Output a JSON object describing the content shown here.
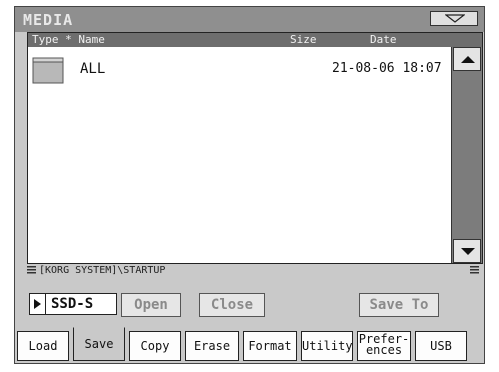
{
  "window": {
    "title": "MEDIA"
  },
  "list": {
    "headers": {
      "type_name": "Type * Name",
      "size": "Size",
      "date": "Date"
    },
    "rows": [
      {
        "name": "ALL",
        "size": "",
        "date": "21-08-06 18:07",
        "icon": "folder-icon"
      }
    ]
  },
  "path": {
    "text": "[KORG SYSTEM]\\STARTUP"
  },
  "device": {
    "label": "SSD-S"
  },
  "buttons": {
    "open": "Open",
    "close": "Close",
    "save_to": "Save To"
  },
  "tabs": {
    "load": "Load",
    "save": "Save",
    "copy": "Copy",
    "erase": "Erase",
    "format": "Format",
    "utility": "Utility",
    "prefs_line1": "Prefer-",
    "prefs_line2": "ences",
    "usb": "USB",
    "active": "Save"
  }
}
